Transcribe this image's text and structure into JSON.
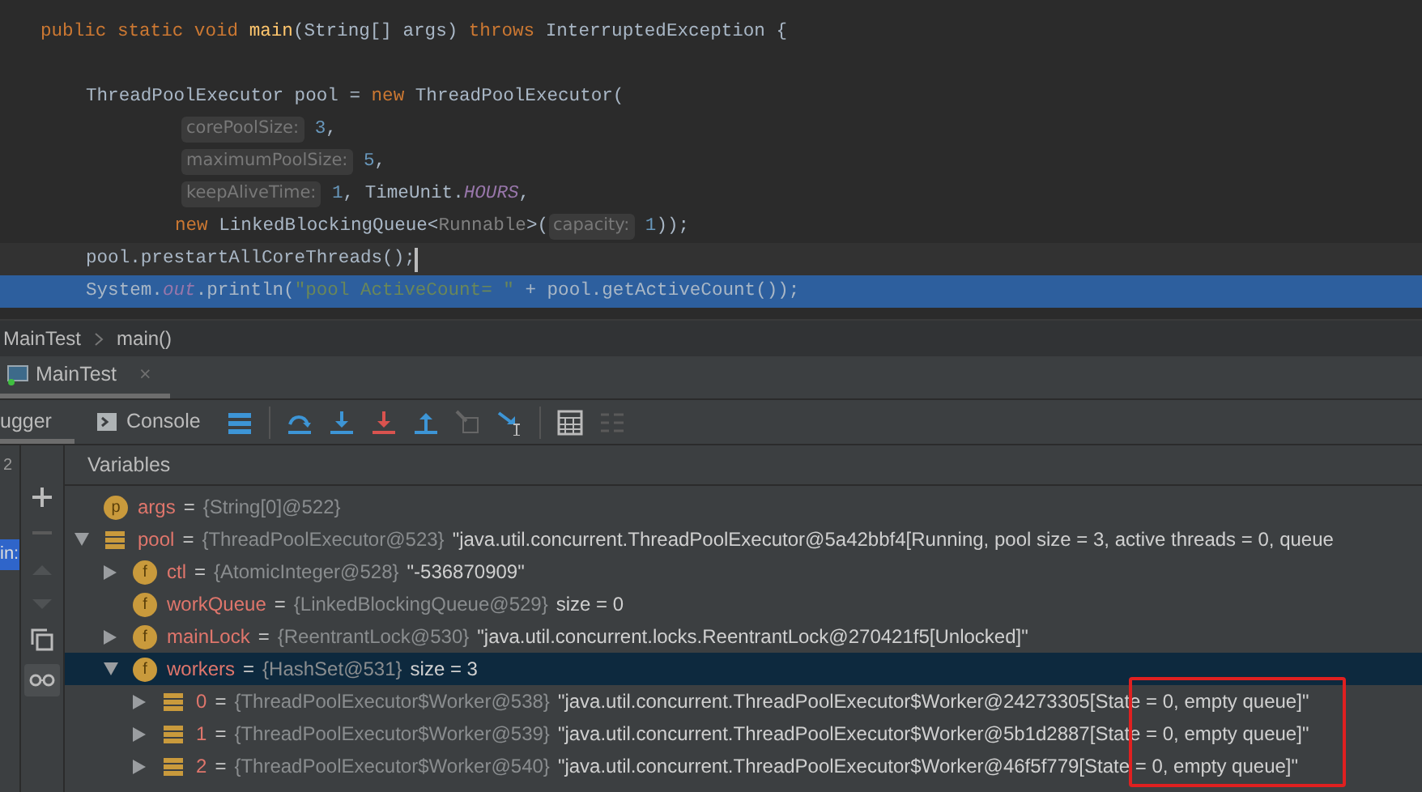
{
  "editor": {
    "lines": [
      {
        "kind": "signature",
        "tokens": [
          {
            "kind": "keyword",
            "text": "public static void "
          },
          {
            "kind": "method",
            "text": "main"
          },
          {
            "kind": "plain",
            "text": "(String[] args) "
          },
          {
            "kind": "keyword",
            "text": "throws "
          },
          {
            "kind": "plain",
            "text": "InterruptedException {"
          }
        ]
      },
      {
        "kind": "blank"
      },
      {
        "kind": "statement",
        "tokens": [
          {
            "kind": "plain",
            "text": "ThreadPoolExecutor pool = "
          },
          {
            "kind": "keyword",
            "text": "new "
          },
          {
            "kind": "plain",
            "text": "ThreadPoolExecutor("
          }
        ]
      },
      {
        "kind": "argument",
        "tokens": [
          {
            "kind": "hint",
            "text": "corePoolSize:"
          },
          {
            "kind": "number",
            "text": " 3"
          },
          {
            "kind": "plain",
            "text": ","
          }
        ]
      },
      {
        "kind": "argument",
        "tokens": [
          {
            "kind": "hint",
            "text": "maximumPoolSize:"
          },
          {
            "kind": "number",
            "text": " 5"
          },
          {
            "kind": "plain",
            "text": ","
          }
        ]
      },
      {
        "kind": "argument",
        "tokens": [
          {
            "kind": "hint",
            "text": "keepAliveTime:"
          },
          {
            "kind": "number",
            "text": " 1"
          },
          {
            "kind": "plain",
            "text": ", TimeUnit."
          },
          {
            "kind": "constant",
            "text": "HOURS"
          },
          {
            "kind": "plain",
            "text": ","
          }
        ]
      },
      {
        "kind": "continuation",
        "tokens": [
          {
            "kind": "keyword",
            "text": "new "
          },
          {
            "kind": "plain",
            "text": "LinkedBlockingQueue<"
          },
          {
            "kind": "generic",
            "text": "Runnable"
          },
          {
            "kind": "plain",
            "text": ">("
          },
          {
            "kind": "hint",
            "text": "capacity:"
          },
          {
            "kind": "number",
            "text": " 1"
          },
          {
            "kind": "plain",
            "text": "));"
          }
        ]
      },
      {
        "kind": "statement",
        "caret": true,
        "tokens": [
          {
            "kind": "plain",
            "text": "pool.prestartAllCoreThreads();"
          }
        ]
      },
      {
        "kind": "statement",
        "selected": true,
        "tokens": [
          {
            "kind": "plain",
            "text": "System."
          },
          {
            "kind": "constant",
            "text": "out"
          },
          {
            "kind": "plain",
            "text": ".println("
          },
          {
            "kind": "string",
            "text": "\"pool ActiveCount= \""
          },
          {
            "kind": "plain",
            "text": " + pool.getActiveCount());"
          }
        ]
      }
    ]
  },
  "breadcrumb": [
    "MainTest",
    "main()"
  ],
  "session_tab": {
    "label": "MainTest",
    "close": "×"
  },
  "debug_tabs": [
    {
      "label": "ugger",
      "selected": true
    },
    {
      "label": "Console",
      "selected": false
    }
  ],
  "left_strip": {
    "count": "2",
    "frame_label": "in:"
  },
  "variables_header": "Variables",
  "variables": [
    {
      "kind": "badge",
      "badge": "p",
      "name": "args",
      "operator": "=",
      "type": "{String[0]@522}",
      "selected": false
    },
    {
      "kind": "list",
      "name": "pool",
      "operator": "=",
      "type": "{ThreadPoolExecutor@523}",
      "value": "\"java.util.concurrent.ThreadPoolExecutor@5a42bbf4[Running, pool size = 3, active threads = 0, queue",
      "expanded": true,
      "selected": false,
      "children": [
        {
          "kind": "badge",
          "badge": "f",
          "name": "ctl",
          "operator": "=",
          "type": "{AtomicInteger@528}",
          "value": "\"-536870909\"",
          "expanded": false,
          "selected": false
        },
        {
          "kind": "badge",
          "badge": "f",
          "name": "workQueue",
          "operator": "=",
          "type": "{LinkedBlockingQueue@529}",
          "value": "size = 0",
          "selected": false
        },
        {
          "kind": "badge",
          "badge": "f",
          "name": "mainLock",
          "operator": "=",
          "type": "{ReentrantLock@530}",
          "value": "\"java.util.concurrent.locks.ReentrantLock@270421f5[Unlocked]\"",
          "expanded": false,
          "selected": false
        },
        {
          "kind": "badge",
          "badge": "f",
          "name": "workers",
          "operator": "=",
          "type": "{HashSet@531}",
          "value": "size = 3",
          "expanded": true,
          "selected": true,
          "children": [
            {
              "kind": "list",
              "name": "0",
              "operator": "=",
              "type": "{ThreadPoolExecutor$Worker@538}",
              "value": "\"java.util.concurrent.ThreadPoolExecutor$Worker@24273305[State = 0, empty queue]\"",
              "expanded": false,
              "selected": false
            },
            {
              "kind": "list",
              "name": "1",
              "operator": "=",
              "type": "{ThreadPoolExecutor$Worker@539}",
              "value": "\"java.util.concurrent.ThreadPoolExecutor$Worker@5b1d2887[State = 0, empty queue]\"",
              "expanded": false,
              "selected": false
            },
            {
              "kind": "list",
              "name": "2",
              "operator": "=",
              "type": "{ThreadPoolExecutor$Worker@540}",
              "value": "\"java.util.concurrent.ThreadPoolExecutor$Worker@46f5f779[State = 0, empty queue]\"",
              "expanded": false,
              "selected": false
            }
          ]
        }
      ]
    }
  ]
}
